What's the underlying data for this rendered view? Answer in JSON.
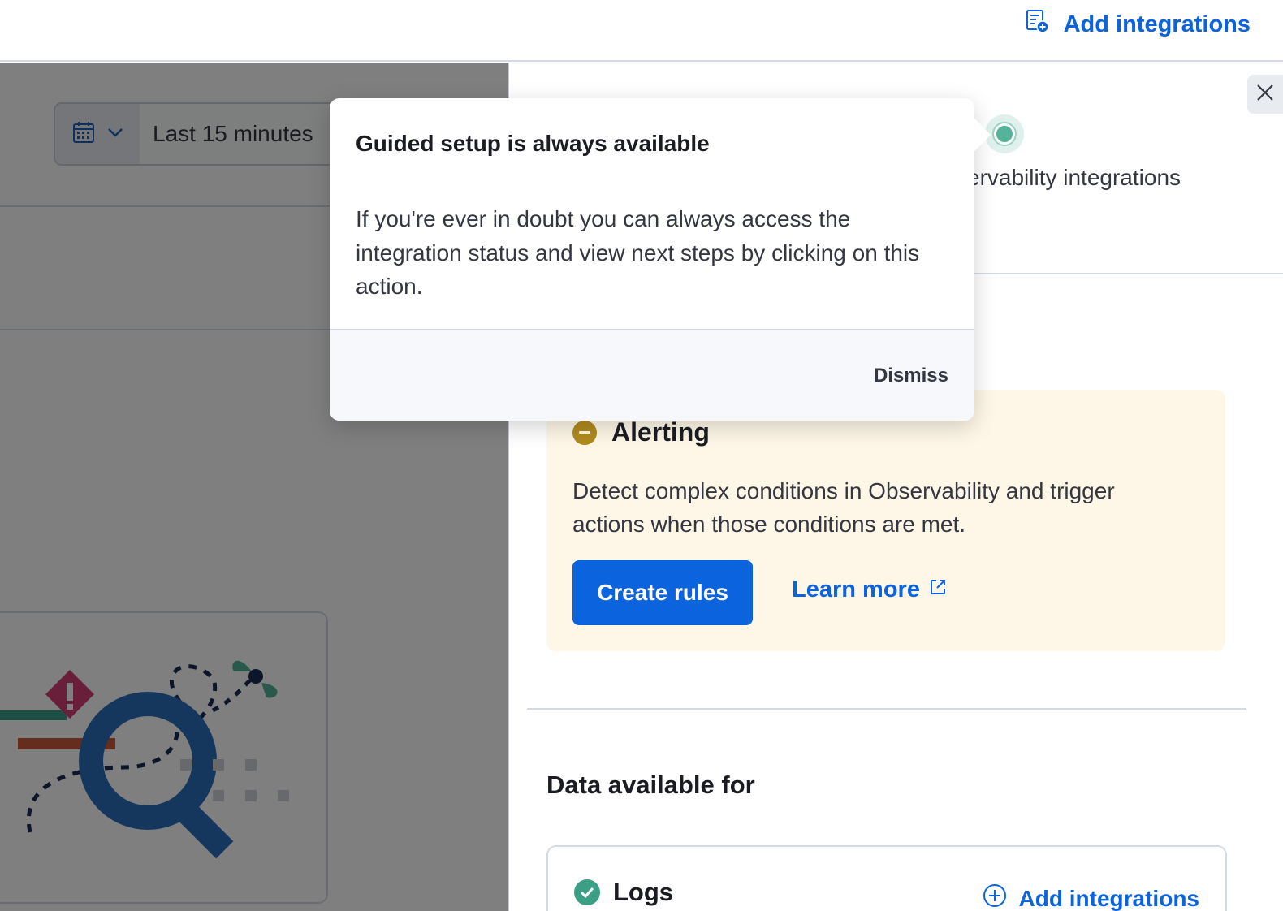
{
  "header": {
    "action_label": "Add integrations",
    "action_icon": "integrations-add-icon"
  },
  "left_page": {
    "date_picker": {
      "quick_icon": "calendar-icon",
      "value": "Last 15 minutes"
    }
  },
  "tour": {
    "title": "Guided setup is always available",
    "body": "If you're ever in doubt you can always access the integration status and view next steps by clicking on this action.",
    "dismiss_label": "Dismiss"
  },
  "flyout": {
    "subtitle_visible": "ervability integrations",
    "close_icon": "close-icon",
    "alerting": {
      "title": "Alerting",
      "status_icon": "minus-circle-icon",
      "description": "Detect complex conditions in Observability and trigger actions when those conditions are met.",
      "primary_button": "Create rules",
      "link_label": "Learn more",
      "link_icon": "external-link-icon"
    },
    "data_section": {
      "title": "Data available for",
      "logs": {
        "title": "Logs",
        "status_icon": "check-circle-icon",
        "action_label": "Add integrations",
        "action_icon": "plus-circle-icon"
      }
    }
  },
  "colors": {
    "primary": "#0b64dd",
    "alert_bg": "#fef7e7",
    "warning_icon": "#b08a1f",
    "success": "#3b9f86",
    "beacon": "#54b399"
  }
}
